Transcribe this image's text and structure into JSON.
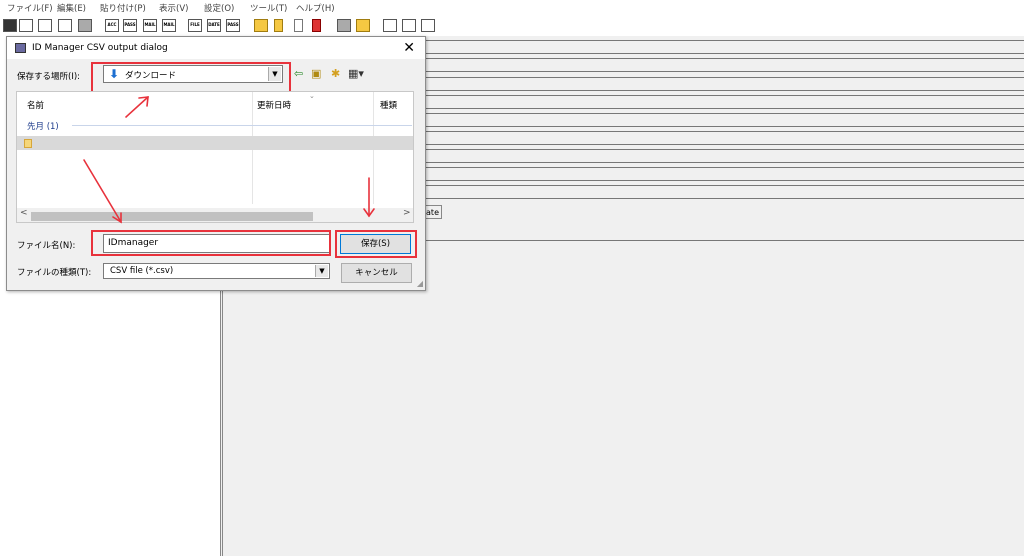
{
  "menubar": {
    "items": [
      "ファイル(F)",
      "編集(E)",
      "貼り付け(P)",
      "表示(V)",
      "設定(O)",
      "ツール(T)",
      "ヘルプ(H)"
    ]
  },
  "toolbar": {
    "icon_labels": [
      "ACC",
      "PASS",
      "MAIL",
      "MAIL",
      "FILE",
      "DATE",
      "PASS"
    ]
  },
  "main": {
    "update_button_label": "ate"
  },
  "dialog": {
    "title": "ID Manager CSV output dialog",
    "close_glyph": "✕",
    "location": {
      "label": "保存する場所(I):",
      "value": "ダウンロード",
      "icon": "download-arrow-icon"
    },
    "file_list": {
      "columns": [
        "名前",
        "更新日時",
        "種類"
      ],
      "group_label": "先月 (1)"
    },
    "filename": {
      "label": "ファイル名(N):",
      "value": "IDmanager"
    },
    "filetype": {
      "label": "ファイルの種類(T):",
      "value": "CSV file (*.csv)"
    },
    "buttons": {
      "save": "保存(S)",
      "cancel": "キャンセル"
    }
  },
  "colors": {
    "highlight": "#e8323c",
    "accent": "#0078d7"
  }
}
